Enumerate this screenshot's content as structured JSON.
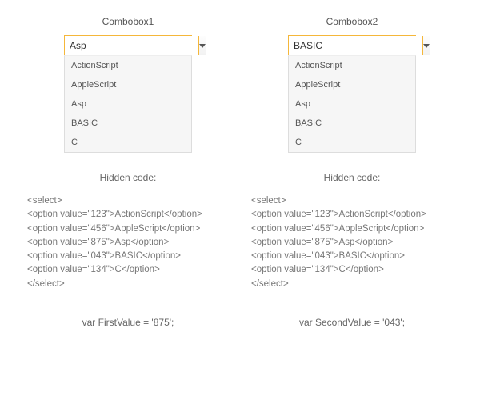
{
  "left": {
    "title": "Combobox1",
    "input_value": "Asp",
    "options": [
      "ActionScript",
      "AppleScript",
      "Asp",
      "BASIC",
      "C"
    ],
    "hidden_label": "Hidden code:",
    "code": "<select>\n<option value=\"123\">ActionScript</option>\n<option value=\"456\">AppleScript</option>\n<option value=\"875\">Asp</option>\n<option value=\"043\">BASIC</option>\n<option value=\"134\">C</option>\n</select>",
    "var_line": "var FirstValue = '875';"
  },
  "right": {
    "title": "Combobox2",
    "input_value": "BASIC",
    "options": [
      "ActionScript",
      "AppleScript",
      "Asp",
      "BASIC",
      "C"
    ],
    "hidden_label": "Hidden code:",
    "code": "<select>\n<option value=\"123\">ActionScript</option>\n<option value=\"456\">AppleScript</option>\n<option value=\"875\">Asp</option>\n<option value=\"043\">BASIC</option>\n<option value=\"134\">C</option>\n</select>",
    "var_line": "var SecondValue = '043';"
  }
}
